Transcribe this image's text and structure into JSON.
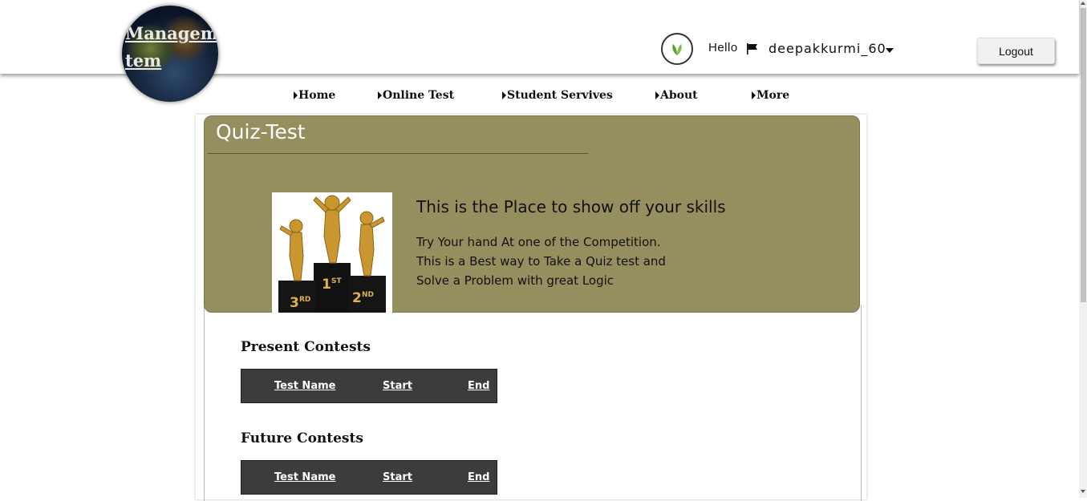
{
  "header": {
    "logo_text_line1": "Manageme",
    "logo_text_line2": "tem",
    "greeting": "Hello",
    "username": "deepakkurmi_60",
    "logout_label": "Logout",
    "avatar_icon": "leaf-icon",
    "flag_icon": "flag-icon"
  },
  "nav": {
    "items": [
      {
        "label": "Home"
      },
      {
        "label": "Online Test"
      },
      {
        "label": "Student Servives"
      },
      {
        "label": "About"
      },
      {
        "label": "More"
      }
    ]
  },
  "banner": {
    "title": "Quiz-Test",
    "headline": "This is the Place to show off your skills",
    "desc_line1": "Try Your hand At one of the Competition.",
    "desc_line2": "This is a Best way to Take a Quiz test and",
    "desc_line3": "Solve a Problem with great Logic",
    "image_labels": {
      "first": "1",
      "first_suffix": "ST",
      "second": "2",
      "second_suffix": "ND",
      "third": "3",
      "third_suffix": "RD"
    },
    "color": "#958f60"
  },
  "present": {
    "title": "Present Contests",
    "columns": [
      "Test Name",
      "Start",
      "End"
    ]
  },
  "future": {
    "title": "Future Contests",
    "columns": [
      "Test Name",
      "Start",
      "End"
    ]
  }
}
